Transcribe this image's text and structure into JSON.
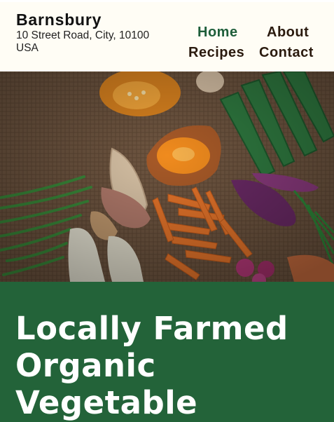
{
  "header": {
    "brand_name": "Barnsbury",
    "address": "10 Street Road, City, 10100 USA"
  },
  "nav": {
    "items": [
      {
        "label": "Home",
        "active": true
      },
      {
        "label": "About"
      },
      {
        "label": "Recipes"
      },
      {
        "label": "Contact"
      }
    ]
  },
  "hero": {
    "image": "fresh-vegetables-on-burlap-photo"
  },
  "banner": {
    "title": "Locally Farmed Organic Vegetable"
  },
  "colors": {
    "header_bg": "#fffdf5",
    "nav_active": "#1e5e3a",
    "nav_text": "#2a1a0e",
    "banner_bg": "#236339",
    "banner_text": "#ffffff"
  }
}
